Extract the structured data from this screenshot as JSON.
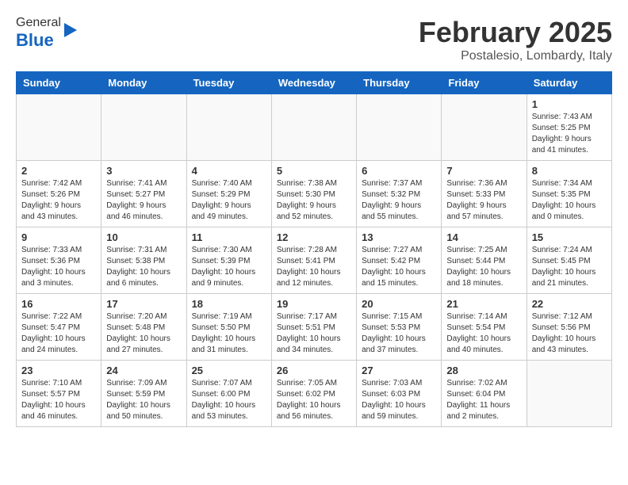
{
  "header": {
    "logo_general": "General",
    "logo_blue": "Blue",
    "month_title": "February 2025",
    "subtitle": "Postalesio, Lombardy, Italy"
  },
  "weekdays": [
    "Sunday",
    "Monday",
    "Tuesday",
    "Wednesday",
    "Thursday",
    "Friday",
    "Saturday"
  ],
  "weeks": [
    [
      {
        "day": "",
        "detail": ""
      },
      {
        "day": "",
        "detail": ""
      },
      {
        "day": "",
        "detail": ""
      },
      {
        "day": "",
        "detail": ""
      },
      {
        "day": "",
        "detail": ""
      },
      {
        "day": "",
        "detail": ""
      },
      {
        "day": "1",
        "detail": "Sunrise: 7:43 AM\nSunset: 5:25 PM\nDaylight: 9 hours and 41 minutes."
      }
    ],
    [
      {
        "day": "2",
        "detail": "Sunrise: 7:42 AM\nSunset: 5:26 PM\nDaylight: 9 hours and 43 minutes."
      },
      {
        "day": "3",
        "detail": "Sunrise: 7:41 AM\nSunset: 5:27 PM\nDaylight: 9 hours and 46 minutes."
      },
      {
        "day": "4",
        "detail": "Sunrise: 7:40 AM\nSunset: 5:29 PM\nDaylight: 9 hours and 49 minutes."
      },
      {
        "day": "5",
        "detail": "Sunrise: 7:38 AM\nSunset: 5:30 PM\nDaylight: 9 hours and 52 minutes."
      },
      {
        "day": "6",
        "detail": "Sunrise: 7:37 AM\nSunset: 5:32 PM\nDaylight: 9 hours and 55 minutes."
      },
      {
        "day": "7",
        "detail": "Sunrise: 7:36 AM\nSunset: 5:33 PM\nDaylight: 9 hours and 57 minutes."
      },
      {
        "day": "8",
        "detail": "Sunrise: 7:34 AM\nSunset: 5:35 PM\nDaylight: 10 hours and 0 minutes."
      }
    ],
    [
      {
        "day": "9",
        "detail": "Sunrise: 7:33 AM\nSunset: 5:36 PM\nDaylight: 10 hours and 3 minutes."
      },
      {
        "day": "10",
        "detail": "Sunrise: 7:31 AM\nSunset: 5:38 PM\nDaylight: 10 hours and 6 minutes."
      },
      {
        "day": "11",
        "detail": "Sunrise: 7:30 AM\nSunset: 5:39 PM\nDaylight: 10 hours and 9 minutes."
      },
      {
        "day": "12",
        "detail": "Sunrise: 7:28 AM\nSunset: 5:41 PM\nDaylight: 10 hours and 12 minutes."
      },
      {
        "day": "13",
        "detail": "Sunrise: 7:27 AM\nSunset: 5:42 PM\nDaylight: 10 hours and 15 minutes."
      },
      {
        "day": "14",
        "detail": "Sunrise: 7:25 AM\nSunset: 5:44 PM\nDaylight: 10 hours and 18 minutes."
      },
      {
        "day": "15",
        "detail": "Sunrise: 7:24 AM\nSunset: 5:45 PM\nDaylight: 10 hours and 21 minutes."
      }
    ],
    [
      {
        "day": "16",
        "detail": "Sunrise: 7:22 AM\nSunset: 5:47 PM\nDaylight: 10 hours and 24 minutes."
      },
      {
        "day": "17",
        "detail": "Sunrise: 7:20 AM\nSunset: 5:48 PM\nDaylight: 10 hours and 27 minutes."
      },
      {
        "day": "18",
        "detail": "Sunrise: 7:19 AM\nSunset: 5:50 PM\nDaylight: 10 hours and 31 minutes."
      },
      {
        "day": "19",
        "detail": "Sunrise: 7:17 AM\nSunset: 5:51 PM\nDaylight: 10 hours and 34 minutes."
      },
      {
        "day": "20",
        "detail": "Sunrise: 7:15 AM\nSunset: 5:53 PM\nDaylight: 10 hours and 37 minutes."
      },
      {
        "day": "21",
        "detail": "Sunrise: 7:14 AM\nSunset: 5:54 PM\nDaylight: 10 hours and 40 minutes."
      },
      {
        "day": "22",
        "detail": "Sunrise: 7:12 AM\nSunset: 5:56 PM\nDaylight: 10 hours and 43 minutes."
      }
    ],
    [
      {
        "day": "23",
        "detail": "Sunrise: 7:10 AM\nSunset: 5:57 PM\nDaylight: 10 hours and 46 minutes."
      },
      {
        "day": "24",
        "detail": "Sunrise: 7:09 AM\nSunset: 5:59 PM\nDaylight: 10 hours and 50 minutes."
      },
      {
        "day": "25",
        "detail": "Sunrise: 7:07 AM\nSunset: 6:00 PM\nDaylight: 10 hours and 53 minutes."
      },
      {
        "day": "26",
        "detail": "Sunrise: 7:05 AM\nSunset: 6:02 PM\nDaylight: 10 hours and 56 minutes."
      },
      {
        "day": "27",
        "detail": "Sunrise: 7:03 AM\nSunset: 6:03 PM\nDaylight: 10 hours and 59 minutes."
      },
      {
        "day": "28",
        "detail": "Sunrise: 7:02 AM\nSunset: 6:04 PM\nDaylight: 11 hours and 2 minutes."
      },
      {
        "day": "",
        "detail": ""
      }
    ]
  ]
}
